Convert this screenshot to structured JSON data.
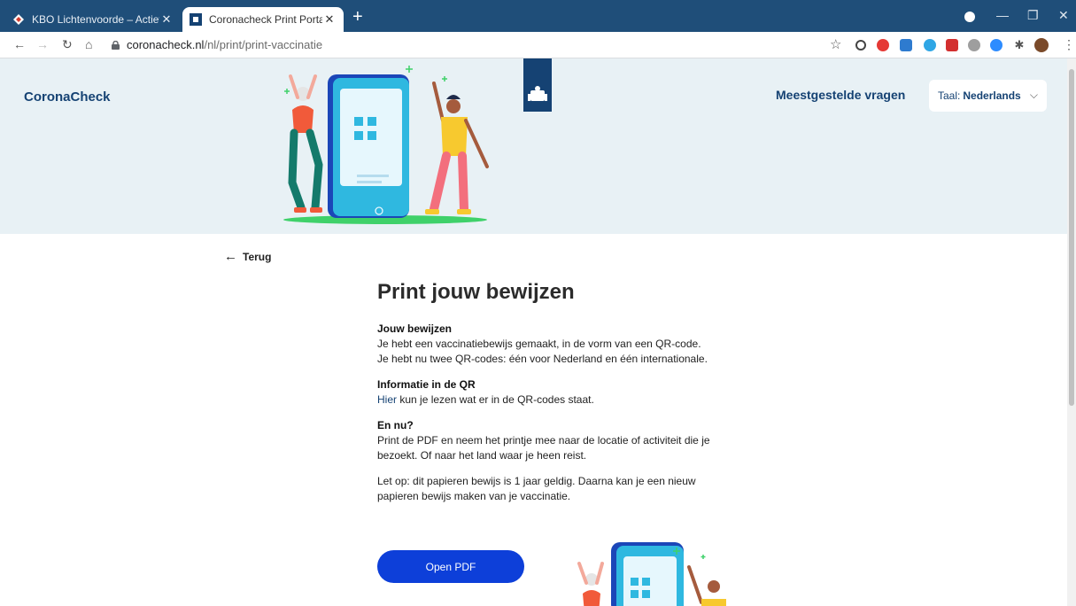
{
  "browser": {
    "tabs": [
      {
        "title": "KBO Lichtenvoorde – Actief voor"
      },
      {
        "title": "Coronacheck Print Portaal"
      }
    ],
    "url_host": "coronacheck.nl",
    "url_path": "/nl/print/print-vaccinatie"
  },
  "header": {
    "brand": "CoronaCheck",
    "faq": "Meestgestelde vragen",
    "lang_prefix": "Taal:",
    "lang_value": "Nederlands"
  },
  "nav": {
    "back": "Terug"
  },
  "main": {
    "title": "Print jouw bewijzen",
    "sections": [
      {
        "heading": "Jouw bewijzen",
        "text": "Je hebt een vaccinatiebewijs gemaakt, in de vorm van een QR-code. Je hebt nu twee QR-codes: één voor Nederland en één internationale."
      },
      {
        "heading": "Informatie in de QR",
        "link": "Hier",
        "text": " kun je lezen wat er in de QR-codes staat."
      },
      {
        "heading": "En nu?",
        "text": "Print de PDF en neem het printje mee naar de locatie of activiteit die je bezoekt. Of naar het land waar je heen reist."
      },
      {
        "heading": "",
        "text": "Let op: dit papieren bewijs is 1 jaar geldig. Daarna kan je een nieuw papieren bewijs maken van je vaccinatie."
      }
    ],
    "button": "Open PDF"
  },
  "colors": {
    "brand_blue": "#154273",
    "hero_bg": "#e8f1f5",
    "button_blue": "#0d3fd9",
    "tabstrip": "#1f4e79"
  }
}
